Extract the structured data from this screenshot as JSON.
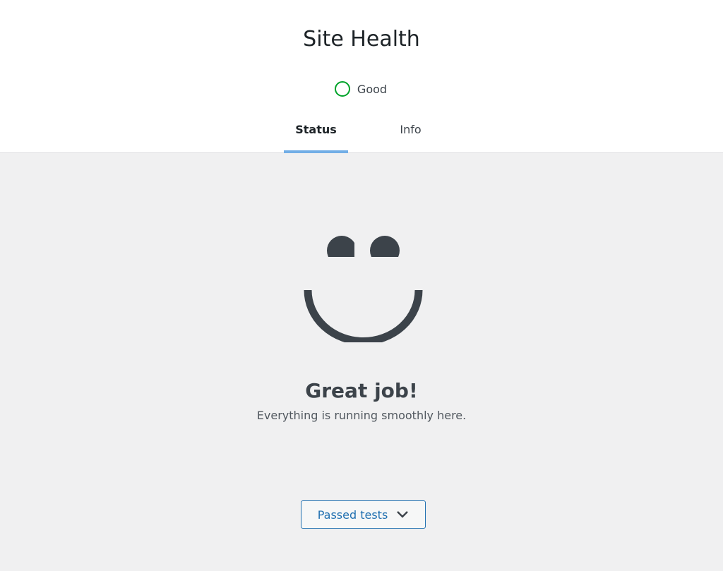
{
  "header": {
    "title": "Site Health",
    "status_label": "Good",
    "status_color": "#00a32a"
  },
  "tabs": [
    {
      "label": "Status",
      "active": true
    },
    {
      "label": "Info",
      "active": false
    }
  ],
  "main": {
    "illustration": "smiley-face-icon",
    "heading": "Great job!",
    "message": "Everything is running smoothly here.",
    "passed_tests_label": "Passed tests",
    "passed_tests_icon": "chevron-down-icon"
  },
  "colors": {
    "accent": "#2271b1",
    "tab_indicator": "#72aee6",
    "face": "#3c434a",
    "background": "#f0f0f1"
  }
}
